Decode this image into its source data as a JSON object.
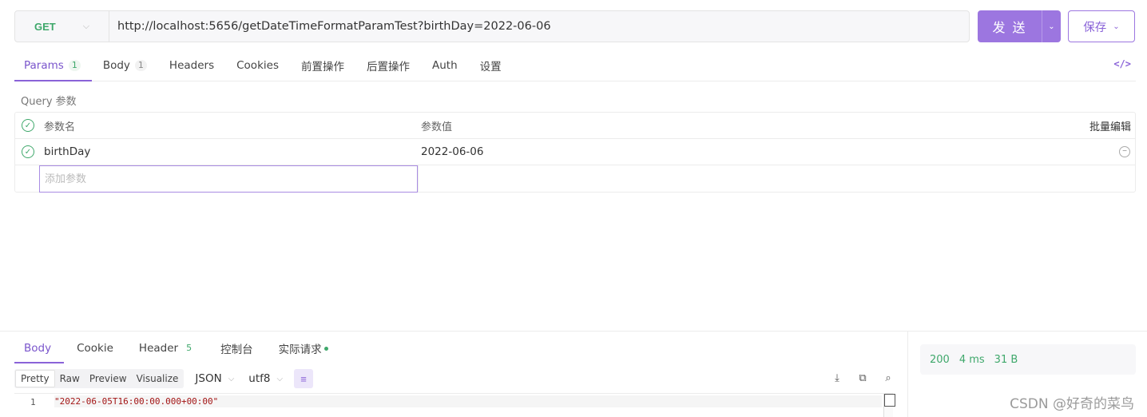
{
  "request": {
    "method": "GET",
    "url": "http://localhost:5656/getDateTimeFormatParamTest?birthDay=2022-06-06",
    "send_label": "发 送",
    "save_label": "保存"
  },
  "tabs": [
    {
      "label": "Params",
      "badge": "1"
    },
    {
      "label": "Body",
      "badge": "1"
    },
    {
      "label": "Headers"
    },
    {
      "label": "Cookies"
    },
    {
      "label": "前置操作"
    },
    {
      "label": "后置操作"
    },
    {
      "label": "Auth"
    },
    {
      "label": "设置"
    }
  ],
  "code_icon": "</>",
  "query": {
    "section_label": "Query 参数",
    "col_name": "参数名",
    "col_value": "参数值",
    "bulk_edit": "批量编辑",
    "rows": [
      {
        "name": "birthDay",
        "value": "2022-06-06"
      }
    ],
    "add_placeholder": "添加参数"
  },
  "response": {
    "tabs": [
      {
        "label": "Body"
      },
      {
        "label": "Cookie"
      },
      {
        "label": "Header",
        "badge": "5"
      },
      {
        "label": "控制台"
      },
      {
        "label": "实际请求"
      }
    ],
    "formats": [
      "Pretty",
      "Raw",
      "Preview",
      "Visualize"
    ],
    "language": "JSON",
    "encoding": "utf8",
    "line_number": "1",
    "body_line": "\"2022-06-05T16:00:00.000+00:00\"",
    "status": "200",
    "time": "4 ms",
    "size": "31 B"
  },
  "watermark": "CSDN @好奇的菜鸟",
  "colors": {
    "accent": "#9c76e0",
    "success": "#3fa86b"
  }
}
